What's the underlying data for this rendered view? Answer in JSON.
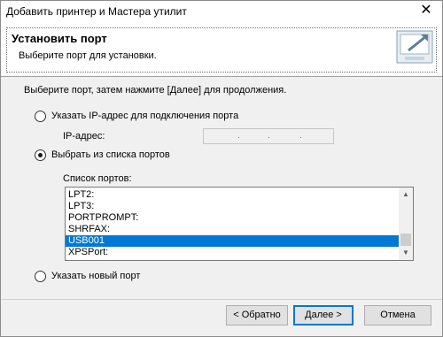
{
  "window": {
    "title": "Добавить принтер и Мастера утилит",
    "close_glyph": "✕"
  },
  "header": {
    "title": "Установить порт",
    "subtitle": "Выберите порт для установки.",
    "icon": "printer-port-icon"
  },
  "main": {
    "instruction": "Выберите порт, затем нажмите [Далее] для продолжения.",
    "option_ip": {
      "label": "Указать IP-адрес для подключения порта",
      "checked": false,
      "ip_label": "IP-адрес:",
      "ip_value": ". . ."
    },
    "option_list": {
      "label": "Выбрать из списка портов",
      "checked": true,
      "list_label": "Список портов:",
      "ports": [
        "LPT2:",
        "LPT3:",
        "PORTPROMPT:",
        "SHRFAX:",
        "USB001",
        "XPSPort:"
      ],
      "selected": "USB001"
    },
    "option_new": {
      "label": "Указать новый порт",
      "checked": false
    }
  },
  "buttons": {
    "back": "< Обратно",
    "next": "Далее >",
    "cancel": "Отмена"
  },
  "colors": {
    "selection": "#0078d7",
    "default_button_border": "#0078d7"
  }
}
